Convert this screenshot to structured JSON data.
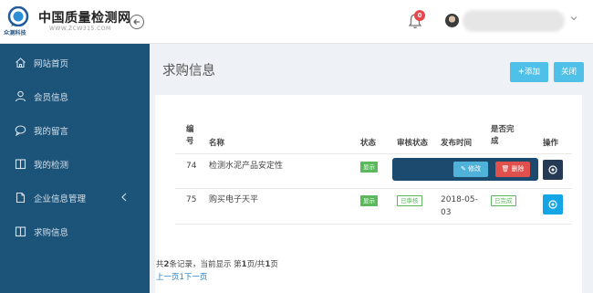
{
  "header": {
    "logo_sub": "众测科技",
    "site_title": "中国质量检测网",
    "site_url": "WWW.ZCW315.COM",
    "notification_count": "0"
  },
  "sidebar": {
    "items": [
      {
        "label": "网站首页",
        "icon": "home-icon"
      },
      {
        "label": "会员信息",
        "icon": "user-icon"
      },
      {
        "label": "我的留言",
        "icon": "message-icon"
      },
      {
        "label": "我的检测",
        "icon": "book-icon"
      },
      {
        "label": "企业信息管理",
        "icon": "document-icon"
      },
      {
        "label": "求购信息",
        "icon": "book-icon"
      }
    ]
  },
  "main": {
    "title": "求购信息",
    "add_label": "添加",
    "close_label": "关闭"
  },
  "table": {
    "headers": {
      "id_line1": "编",
      "id_line2": "号",
      "name": "名称",
      "status": "状态",
      "review": "审核状态",
      "time": "发布时间",
      "done_line1": "是否完",
      "done_line2": "成",
      "ops": "操作"
    },
    "rows": [
      {
        "id": "74",
        "name": "检测水泥产品安定性",
        "status": "显示",
        "review": "",
        "time_line1": "",
        "time_line2": "",
        "done": ""
      },
      {
        "id": "75",
        "name": "购买电子天平",
        "status": "显示",
        "review": "已审核",
        "time_line1": "2018-05-",
        "time_line2": "03",
        "done": "已完成"
      }
    ],
    "edit_label": "修改",
    "delete_label": "删除"
  },
  "pager": {
    "summary_prefix": "共",
    "total": "2",
    "summary_mid": "条记录，当前显示 第",
    "page": "1",
    "summary_sep": "页/共",
    "pages": "1",
    "summary_suffix": "页",
    "links": "上一页1下一页"
  },
  "colors": {
    "sidebar": "#1c5379",
    "accent": "#4fc0e8",
    "danger": "#e0504c",
    "success": "#5cb85c"
  }
}
